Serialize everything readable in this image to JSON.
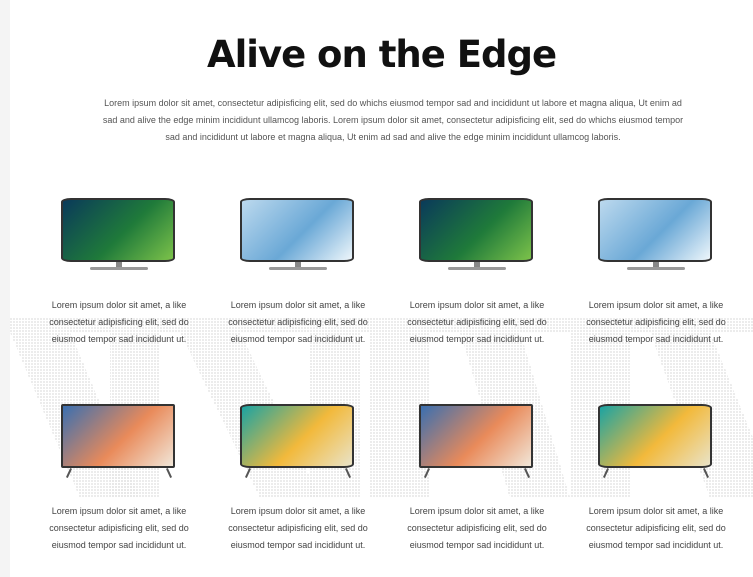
{
  "section": {
    "title": "Alive on the Edge",
    "intro": "Lorem ipsum dolor sit amet, consectetur adipisficing elit, sed do whichs eiusmod tempor sad and incididunt ut labore et magna aliqua, Ut enim ad sad and alive the edge minim incididunt ullamcog laboris. Lorem ipsum dolor sit amet, consectetur adipisficing elit, sed do whichs eiusmod tempor sad and incididunt ut labore et magna aliqua, Ut enim ad sad and alive the edge minim incididunt ullamcog laboris."
  },
  "products": [
    {
      "image": "tv-curved-leaf-icon",
      "text": "Lorem ipsum dolor sit amet, a like consectetur adipisficing elit, sed do eiusmod tempor sad incididunt ut.",
      "colors": [
        "#0a3a5a",
        "#1f7a3a",
        "#7cc24a"
      ]
    },
    {
      "image": "tv-curved-ice-icon",
      "text": "Lorem ipsum dolor sit amet, a like consectetur adipisficing elit, sed do eiusmod tempor sad incididunt ut.",
      "colors": [
        "#bcd9ee",
        "#6aa8d6",
        "#eef6fb"
      ]
    },
    {
      "image": "tv-curved-leaf-icon",
      "text": "Lorem ipsum dolor sit amet, a like consectetur adipisficing elit, sed do eiusmod tempor sad incididunt ut.",
      "colors": [
        "#0a3a5a",
        "#1f7a3a",
        "#7cc24a"
      ]
    },
    {
      "image": "tv-curved-ice-icon",
      "text": "Lorem ipsum dolor sit amet, a like consectetur adipisficing elit, sed do eiusmod tempor sad incididunt ut.",
      "colors": [
        "#bcd9ee",
        "#6aa8d6",
        "#eef6fb"
      ]
    },
    {
      "image": "tv-flat-canyon-icon",
      "text": "Lorem ipsum dolor sit amet, a like consectetur adipisficing elit, sed do eiusmod tempor sad incididunt ut.",
      "colors": [
        "#3a6fb0",
        "#e98a5a",
        "#f1e6d8"
      ]
    },
    {
      "image": "tv-curved-beach-icon",
      "text": "Lorem ipsum dolor sit amet, a like consectetur adipisficing elit, sed do eiusmod tempor sad incididunt ut.",
      "colors": [
        "#1aa3a3",
        "#f2b93b",
        "#e9e3c8"
      ]
    },
    {
      "image": "tv-flat-canyon-icon",
      "text": "Lorem ipsum dolor sit amet, a like consectetur adipisficing elit, sed do eiusmod tempor sad incididunt ut.",
      "colors": [
        "#3a6fb0",
        "#e98a5a",
        "#f1e6d8"
      ]
    },
    {
      "image": "tv-curved-beach-icon",
      "text": "Lorem ipsum dolor sit amet, a like consectetur adipisficing elit, sed do eiusmod tempor sad incididunt ut.",
      "colors": [
        "#1aa3a3",
        "#f2b93b",
        "#e9e3c8"
      ]
    }
  ]
}
